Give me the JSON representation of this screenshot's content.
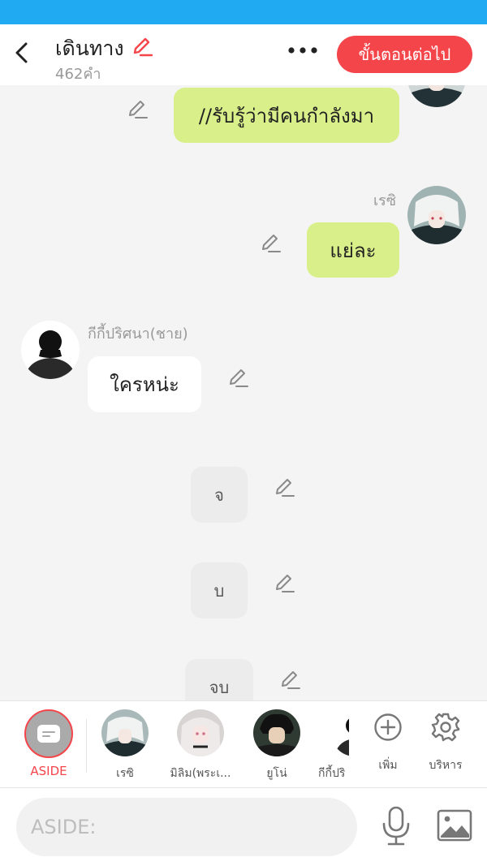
{
  "header": {
    "title": "เดินทาง",
    "word_count": "462คำ",
    "next_button": "ขั้นตอนต่อไป"
  },
  "messages": [
    {
      "type": "right",
      "text": "//รับรู้ว่ามีคนกำลังมา"
    },
    {
      "type": "right",
      "sender": "เรซิ",
      "text": "แย่ละ"
    },
    {
      "type": "left",
      "sender": "กีกี้ปริศนา(ชาย)",
      "text": "ใครหน่ะ"
    },
    {
      "type": "narration",
      "text": "จ"
    },
    {
      "type": "narration",
      "text": "บ"
    },
    {
      "type": "narration",
      "text": "จบ"
    }
  ],
  "bottombar": {
    "aside_label": "ASIDE",
    "characters": [
      {
        "label": "เรซิ"
      },
      {
        "label": "มิลิม(พระเ..."
      },
      {
        "label": "ยูโน่"
      },
      {
        "label": "กีกี้ปริ"
      }
    ],
    "add_label": "เพิ่ม",
    "manage_label": "บริหาร"
  },
  "composer": {
    "placeholder": "ASIDE:"
  },
  "colors": {
    "status_bar": "#1faaf2",
    "accent": "#f4454b",
    "right_bubble": "#d9f08a"
  }
}
